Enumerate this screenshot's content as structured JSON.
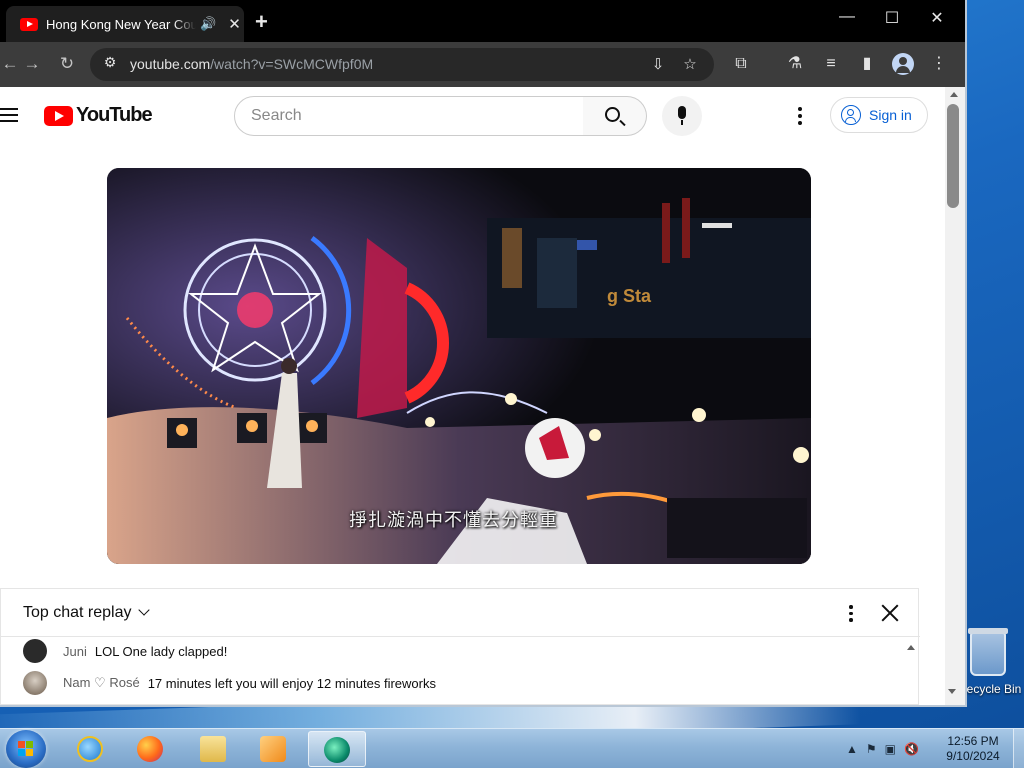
{
  "browser": {
    "tab": {
      "title": "Hong Kong New Year Countdown",
      "audio_icon": "speaker-icon",
      "close": "✕"
    },
    "new_tab": "+",
    "window_controls": {
      "minimize": "—",
      "maximize": "☐",
      "close": "✕"
    },
    "nav": {
      "back": "←",
      "forward": "→",
      "reload": "↻"
    },
    "address": {
      "host": "youtube.com",
      "path": "/watch?v=SWcMCWfpf0M"
    },
    "icons": [
      "site-info-icon",
      "install-app-icon",
      "bookmark-star-icon",
      "extensions-icon",
      "labs-flask-icon",
      "media-control-icon",
      "side-panel-icon",
      "profile-icon",
      "chrome-menu-icon"
    ]
  },
  "youtube": {
    "logo_text": "YouTube",
    "search": {
      "placeholder": "Search",
      "value": ""
    },
    "sign_in": "Sign in",
    "video": {
      "subtitle": "掙扎漩渦中不懂去分輕重"
    },
    "chat": {
      "title": "Top chat replay",
      "messages": [
        {
          "author": "Juni",
          "text": "LOL One lady clapped!"
        },
        {
          "author": "Nam ♡ Rosé",
          "text": "17 minutes left you will enjoy 12 minutes fireworks"
        }
      ]
    }
  },
  "desktop": {
    "recycle_bin_label": "Recycle Bin"
  },
  "taskbar": {
    "apps": [
      "internet-explorer",
      "firefox",
      "file-explorer",
      "media-player",
      "active-app"
    ],
    "clock": {
      "time": "12:56 PM",
      "date": "9/10/2024"
    }
  },
  "colors": {
    "youtube_red": "#ff0000",
    "link_blue": "#065fd4",
    "chrome_dark": "#3c3c3c"
  }
}
